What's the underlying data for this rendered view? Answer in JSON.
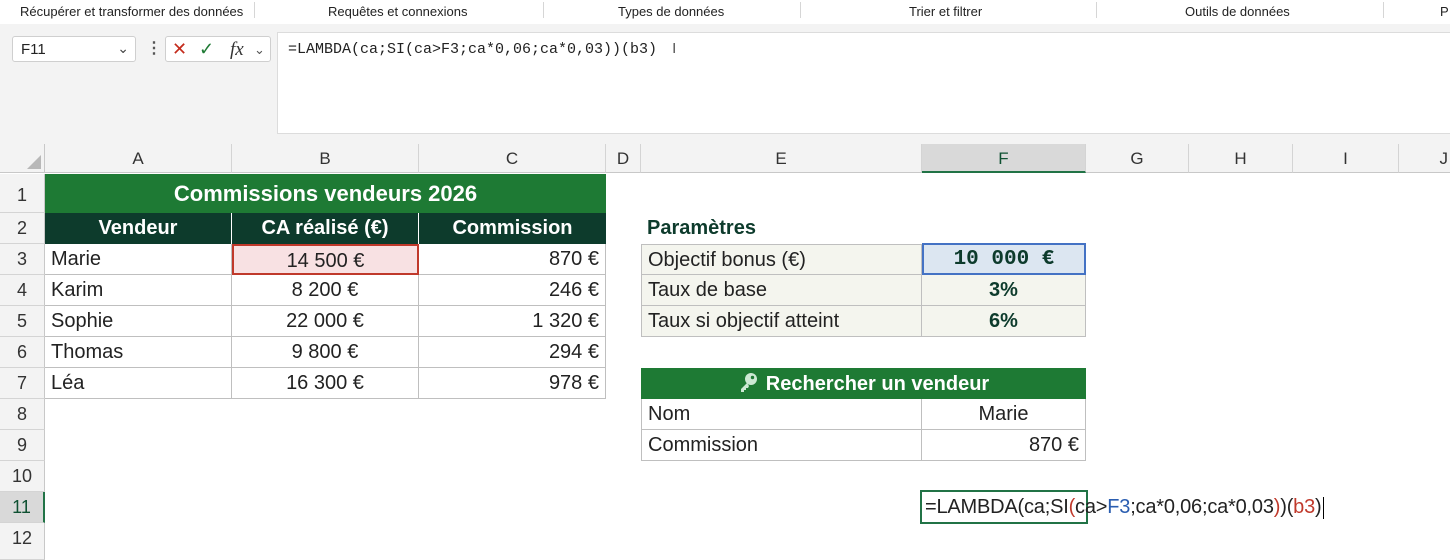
{
  "ribbon": {
    "groups": [
      "Récupérer et transformer des données",
      "Requêtes et connexions",
      "Types de données",
      "Trier et filtrer",
      "Outils de données",
      "P"
    ]
  },
  "formula_bar": {
    "name_box": "F11",
    "formula": "=LAMBDA(ca;SI(ca>F3;ca*0,06;ca*0,03))(b3)"
  },
  "columns": [
    "A",
    "B",
    "C",
    "D",
    "E",
    "F",
    "G",
    "H",
    "I",
    "J"
  ],
  "rows": [
    "1",
    "2",
    "3",
    "4",
    "5",
    "6",
    "7",
    "8",
    "9",
    "10",
    "11",
    "12"
  ],
  "table": {
    "title": "Commissions vendeurs 2026",
    "headers": [
      "Vendeur",
      "CA réalisé (€)",
      "Commission"
    ],
    "rows": [
      [
        "Marie",
        "14 500 €",
        "870 €"
      ],
      [
        "Karim",
        "8 200 €",
        "246 €"
      ],
      [
        "Sophie",
        "22 000 €",
        "1 320 €"
      ],
      [
        "Thomas",
        "9 800 €",
        "294 €"
      ],
      [
        "Léa",
        "16 300 €",
        "978 €"
      ]
    ]
  },
  "params": {
    "title": "Paramètres",
    "rows": [
      [
        "Objectif bonus (€)",
        "10 000 €"
      ],
      [
        "Taux de base",
        "3%"
      ],
      [
        "Taux si objectif atteint",
        "6%"
      ]
    ]
  },
  "search": {
    "title": "Rechercher un vendeur",
    "icon": "key-icon",
    "rows": [
      [
        "Nom",
        "Marie"
      ],
      [
        "Commission",
        "870 €"
      ]
    ]
  },
  "edit_cell": {
    "parts": [
      {
        "t": "=LAMBDA(ca;SI",
        "c": "#222222"
      },
      {
        "t": "(",
        "c": "#c0392b"
      },
      {
        "t": "ca>",
        "c": "#222222"
      },
      {
        "t": "F3",
        "c": "#2a5db0"
      },
      {
        "t": ";ca*0,06;ca*0,03",
        "c": "#222222"
      },
      {
        "t": ")",
        "c": "#c0392b"
      },
      {
        "t": ")",
        "c": "#222222"
      },
      {
        "t": "(",
        "c": "#222222"
      },
      {
        "t": "b3",
        "c": "#c0392b"
      },
      {
        "t": ")",
        "c": "#222222"
      }
    ]
  },
  "colors": {
    "accent_green": "#217346",
    "title_green": "#1e7a34",
    "header_dark": "#0d3b2c",
    "selected_param_bg": "#dce6f1",
    "selected_param_border": "#4472c4",
    "ref_highlight_border": "#c0392b"
  }
}
